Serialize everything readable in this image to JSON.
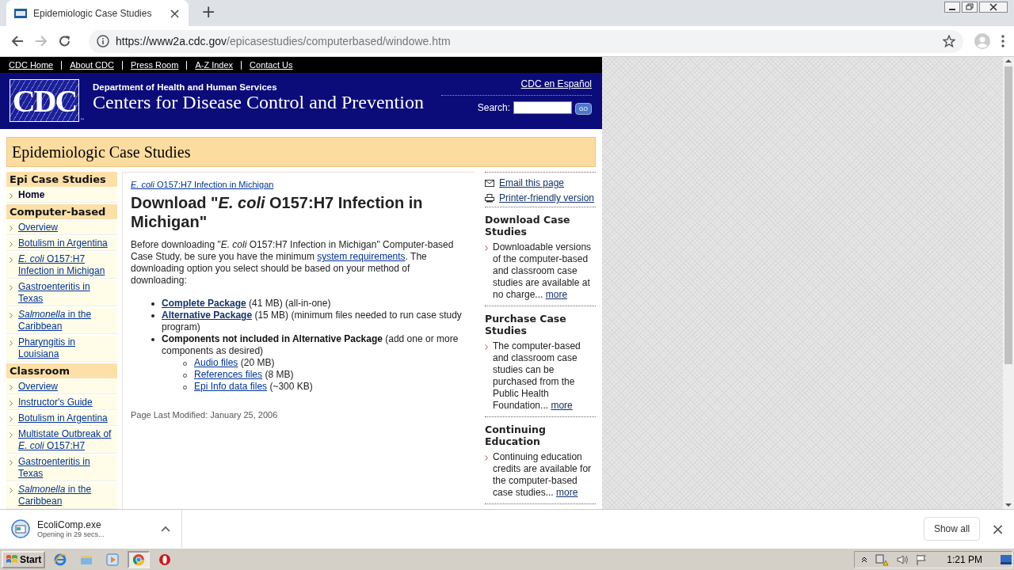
{
  "browser": {
    "tab": {
      "title": "Epidemiologic Case Studies",
      "close": "×"
    },
    "new_tab": "+",
    "url": {
      "host": "https://www2a.cdc.gov",
      "path": "/epicasestudies/computerbased/windowe.htm"
    }
  },
  "page": {
    "top_links": [
      "CDC Home",
      "About CDC",
      "Press Room",
      "A-Z Index",
      "Contact Us"
    ],
    "header": {
      "logo": "CDC",
      "tm": "™",
      "department": "Department of Health and Human Services",
      "agency": "Centers for Disease Control and Prevention",
      "espanol": "CDC en Español",
      "search_label": "Search:",
      "go": "GO"
    },
    "banner": "Epidemiologic Case Studies",
    "sidebar": [
      {
        "heading": "Epi Case Studies",
        "items": [
          {
            "label": "Home",
            "kind": "current"
          }
        ]
      },
      {
        "heading": "Computer-based",
        "items": [
          {
            "label": "Overview",
            "kind": "link"
          },
          {
            "label": "Botulism in Argentina",
            "kind": "link"
          },
          {
            "label": "*E. coli* O157:H7 Infection in Michigan",
            "kind": "link"
          },
          {
            "label": "Gastroenteritis in Texas",
            "kind": "link"
          },
          {
            "label": "*Salmonella* in the Caribbean",
            "kind": "link"
          },
          {
            "label": "Pharyngitis in Louisiana",
            "kind": "link"
          }
        ]
      },
      {
        "heading": "Classroom",
        "items": [
          {
            "label": "Overview",
            "kind": "link"
          },
          {
            "label": "Instructor's Guide",
            "kind": "link"
          },
          {
            "label": "Botulism in Argentina",
            "kind": "link"
          },
          {
            "label": "Multistate Outbreak of *E. coli* O157:H7",
            "kind": "link"
          },
          {
            "label": "Gastroenteritis in Texas",
            "kind": "link"
          },
          {
            "label": "*Salmonella* in the Caribbean",
            "kind": "link"
          }
        ]
      }
    ],
    "main": {
      "breadcrumb": "*E. coli* O157:H7 Infection in Michigan",
      "title": "Download \"*E. coli* O157:H7 Infection in Michigan\"",
      "intro": [
        {
          "kind": "text",
          "text": "Before downloading \"*E. coli* O157:H7 Infection in Michigan\" Computer-based Case Study, be sure you have the minimum "
        },
        {
          "kind": "link",
          "text": "system requirements"
        },
        {
          "kind": "text",
          "text": ". The downloading option you select should be based on your method of downloading:"
        }
      ],
      "options": [
        {
          "kind": "link",
          "label": "Complete Package",
          "note": "(41 MB) (all-in-one)"
        },
        {
          "kind": "link",
          "label": "Alternative Package",
          "note": "(15 MB) (minimum files needed to run case study program)"
        },
        {
          "kind": "text",
          "label": "Components not included in Alternative Package",
          "note": "(add one or more components as desired)",
          "children": [
            {
              "kind": "link",
              "label": "Audio files",
              "note": "(20 MB)"
            },
            {
              "kind": "link",
              "label": "References files",
              "note": "(8 MB)"
            },
            {
              "kind": "link",
              "label": "Epi Info data files",
              "note": "(~300 KB)"
            }
          ]
        }
      ],
      "modified": "Page Last Modified: January 25, 2006"
    },
    "tools": [
      {
        "kind": "email",
        "label": "Email this page"
      },
      {
        "kind": "print",
        "label": "Printer-friendly version"
      }
    ],
    "boxes": [
      {
        "heading": "Download Case Studies",
        "text": "Downloadable versions of the computer-based and classroom case studies are available at no charge...",
        "more": "more"
      },
      {
        "heading": "Purchase Case Studies",
        "text": "The computer-based and classroom case studies can be purchased from the Public Health Foundation...",
        "more": "more"
      },
      {
        "heading": "Continuing Education",
        "text": "Continuing education credits are available for the computer-based case studies...",
        "more": "more"
      }
    ]
  },
  "downloads": {
    "file": "EcoliComp.exe",
    "status": "Opening in 29 secs...",
    "show_all": "Show all",
    "close": "×"
  },
  "taskbar": {
    "start": "Start",
    "apps": [
      {
        "kind": "ie",
        "selected": false
      },
      {
        "kind": "folder",
        "selected": false
      },
      {
        "kind": "media",
        "selected": false
      },
      {
        "kind": "chrome",
        "selected": true
      },
      {
        "kind": "opera",
        "selected": false
      }
    ],
    "time": "1:21 PM"
  }
}
